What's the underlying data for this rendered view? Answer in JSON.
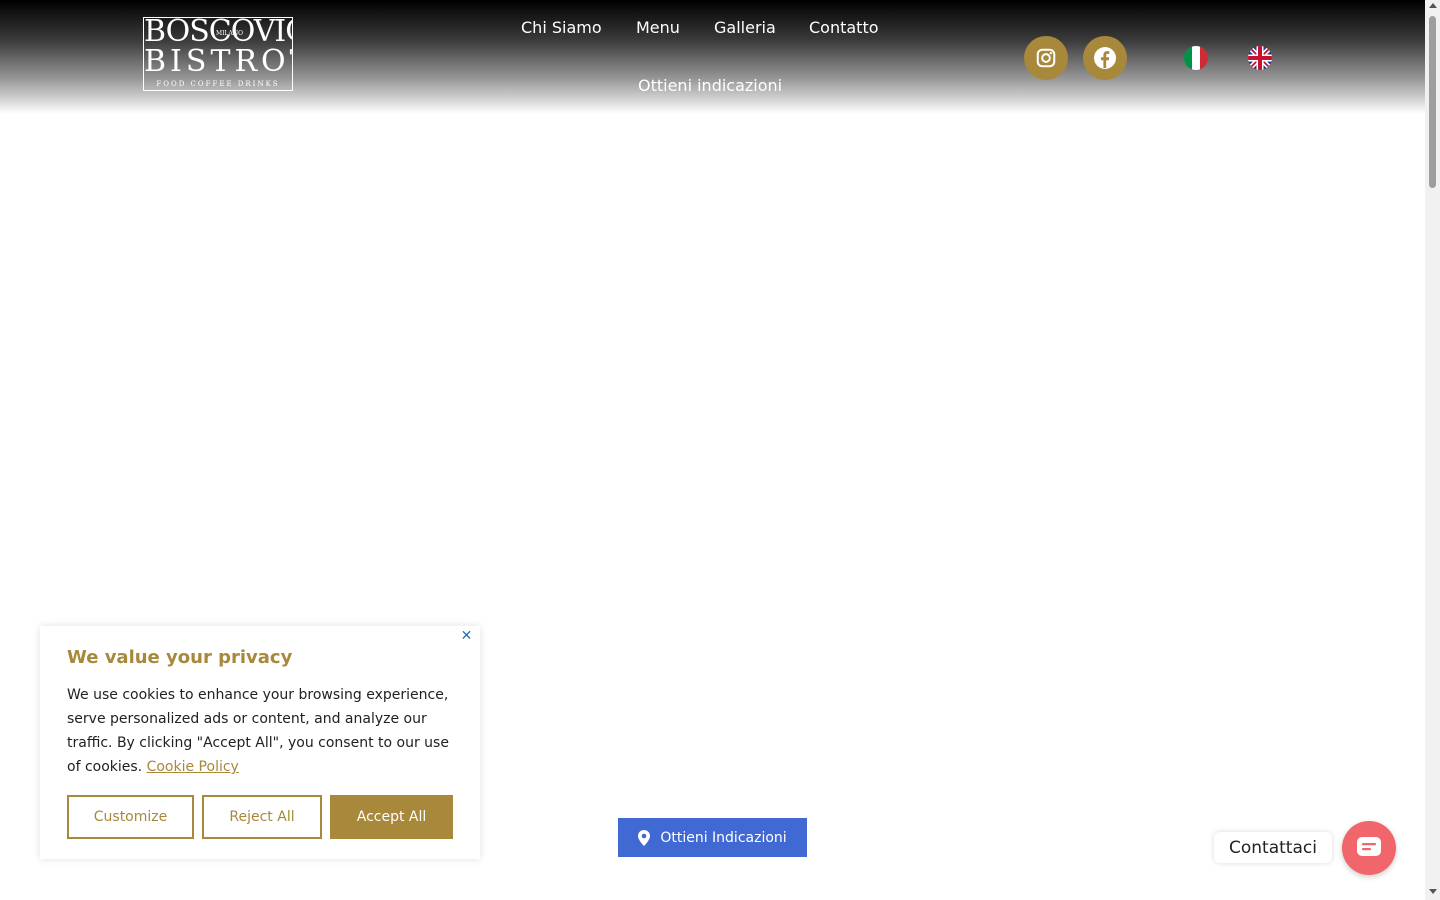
{
  "logo": {
    "line1": "BOSCOVICH",
    "small": "MILANO",
    "line2": "BISTROT",
    "line3": "FOOD COFFEE DRINKS"
  },
  "nav": {
    "items": [
      "Chi Siamo",
      "Menu",
      "Galleria",
      "Contatto",
      "Ottieni indicazioni"
    ]
  },
  "social": {
    "instagram_icon": "instagram-icon",
    "facebook_icon": "facebook-icon",
    "color": "#a8883a"
  },
  "languages": {
    "it_icon": "italy-flag-icon",
    "en_icon": "uk-flag-icon"
  },
  "cookie": {
    "title": "We value your privacy",
    "text": "We use cookies to enhance your browsing experience, serve personalized ads or content, and analyze our traffic. By clicking \"Accept All\", you consent to our use of cookies.",
    "policy_link": "Cookie Policy",
    "customize": "Customize",
    "reject": "Reject All",
    "accept": "Accept All",
    "accent": "#a8883a"
  },
  "directions": {
    "label": "Ottieni Indicazioni",
    "color": "#4169d4"
  },
  "contact": {
    "label": "Contattaci",
    "color": "#f0666a"
  }
}
